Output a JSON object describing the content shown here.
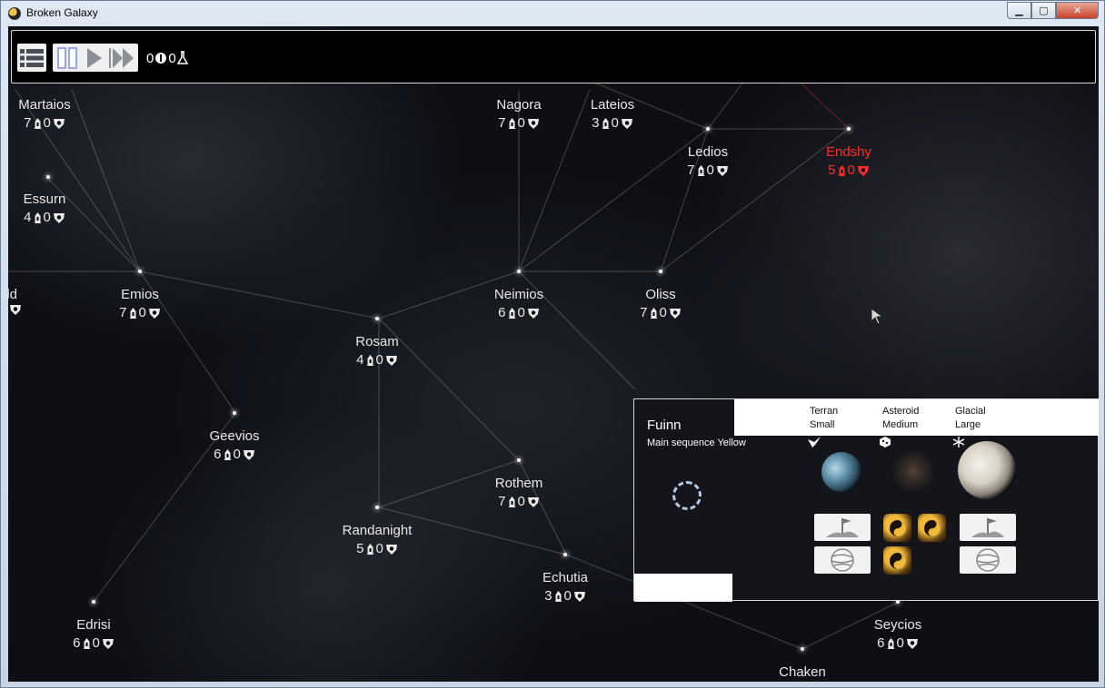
{
  "window": {
    "title": "Broken Galaxy",
    "minimize_label": "▁",
    "maximize_label": "▢",
    "close_label": "✕"
  },
  "toolbar": {
    "menu_icon": "list-icon",
    "pause_icon": "pause-icon",
    "play_icon": "play-icon",
    "fast_icon": "fast-forward-icon",
    "res_a_value": "0",
    "res_a_icon": "credits-icon",
    "res_b_value": "0",
    "res_b_icon": "research-flask-icon"
  },
  "colors": {
    "enemy": "#ff2c2c",
    "normal": "#e9e9e9",
    "panel_bg": "#14151b"
  },
  "stars": [
    {
      "id": "martaios",
      "name": "Martaios",
      "ships": "7",
      "planets": "0",
      "enemy": false
    },
    {
      "id": "essurn",
      "name": "Essurn",
      "ships": "4",
      "planets": "0",
      "enemy": false
    },
    {
      "id": "old",
      "name": "old",
      "ships": "",
      "planets": "",
      "enemy": false
    },
    {
      "id": "emios",
      "name": "Emios",
      "ships": "7",
      "planets": "0",
      "enemy": false
    },
    {
      "id": "nagora",
      "name": "Nagora",
      "ships": "7",
      "planets": "0",
      "enemy": false
    },
    {
      "id": "lateios",
      "name": "Lateios",
      "ships": "3",
      "planets": "0",
      "enemy": false
    },
    {
      "id": "ledios",
      "name": "Ledios",
      "ships": "7",
      "planets": "0",
      "enemy": false
    },
    {
      "id": "endshy",
      "name": "Endshy",
      "ships": "5",
      "planets": "0",
      "enemy": true
    },
    {
      "id": "neimios",
      "name": "Neimios",
      "ships": "6",
      "planets": "0",
      "enemy": false
    },
    {
      "id": "oliss",
      "name": "Oliss",
      "ships": "7",
      "planets": "0",
      "enemy": false
    },
    {
      "id": "rosam",
      "name": "Rosam",
      "ships": "4",
      "planets": "0",
      "enemy": false
    },
    {
      "id": "geevios",
      "name": "Geevios",
      "ships": "6",
      "planets": "0",
      "enemy": false
    },
    {
      "id": "rothem",
      "name": "Rothem",
      "ships": "7",
      "planets": "0",
      "enemy": false
    },
    {
      "id": "randanight",
      "name": "Randanight",
      "ships": "5",
      "planets": "0",
      "enemy": false
    },
    {
      "id": "echutia",
      "name": "Echutia",
      "ships": "3",
      "planets": "0",
      "enemy": false
    },
    {
      "id": "edrisi",
      "name": "Edrisi",
      "ships": "6",
      "planets": "0",
      "enemy": false
    },
    {
      "id": "seycios",
      "name": "Seycios",
      "ships": "6",
      "planets": "0",
      "enemy": false
    },
    {
      "id": "chaken",
      "name": "Chaken",
      "ships": "",
      "planets": "",
      "enemy": false
    }
  ],
  "top_partial_stats": [
    {
      "ships": "",
      "planets": ""
    },
    {
      "ships": "",
      "planets": ""
    }
  ],
  "system_panel": {
    "name": "Fuinn",
    "star_type": "Main sequence Yellow",
    "planets": [
      {
        "type": "Terran",
        "size": "Small",
        "type_icon": "bird-icon"
      },
      {
        "type": "Asteroid",
        "size": "Medium",
        "type_icon": "dice-icon"
      },
      {
        "type": "Glacial",
        "size": "Large",
        "type_icon": "snowflake-icon"
      }
    ]
  }
}
